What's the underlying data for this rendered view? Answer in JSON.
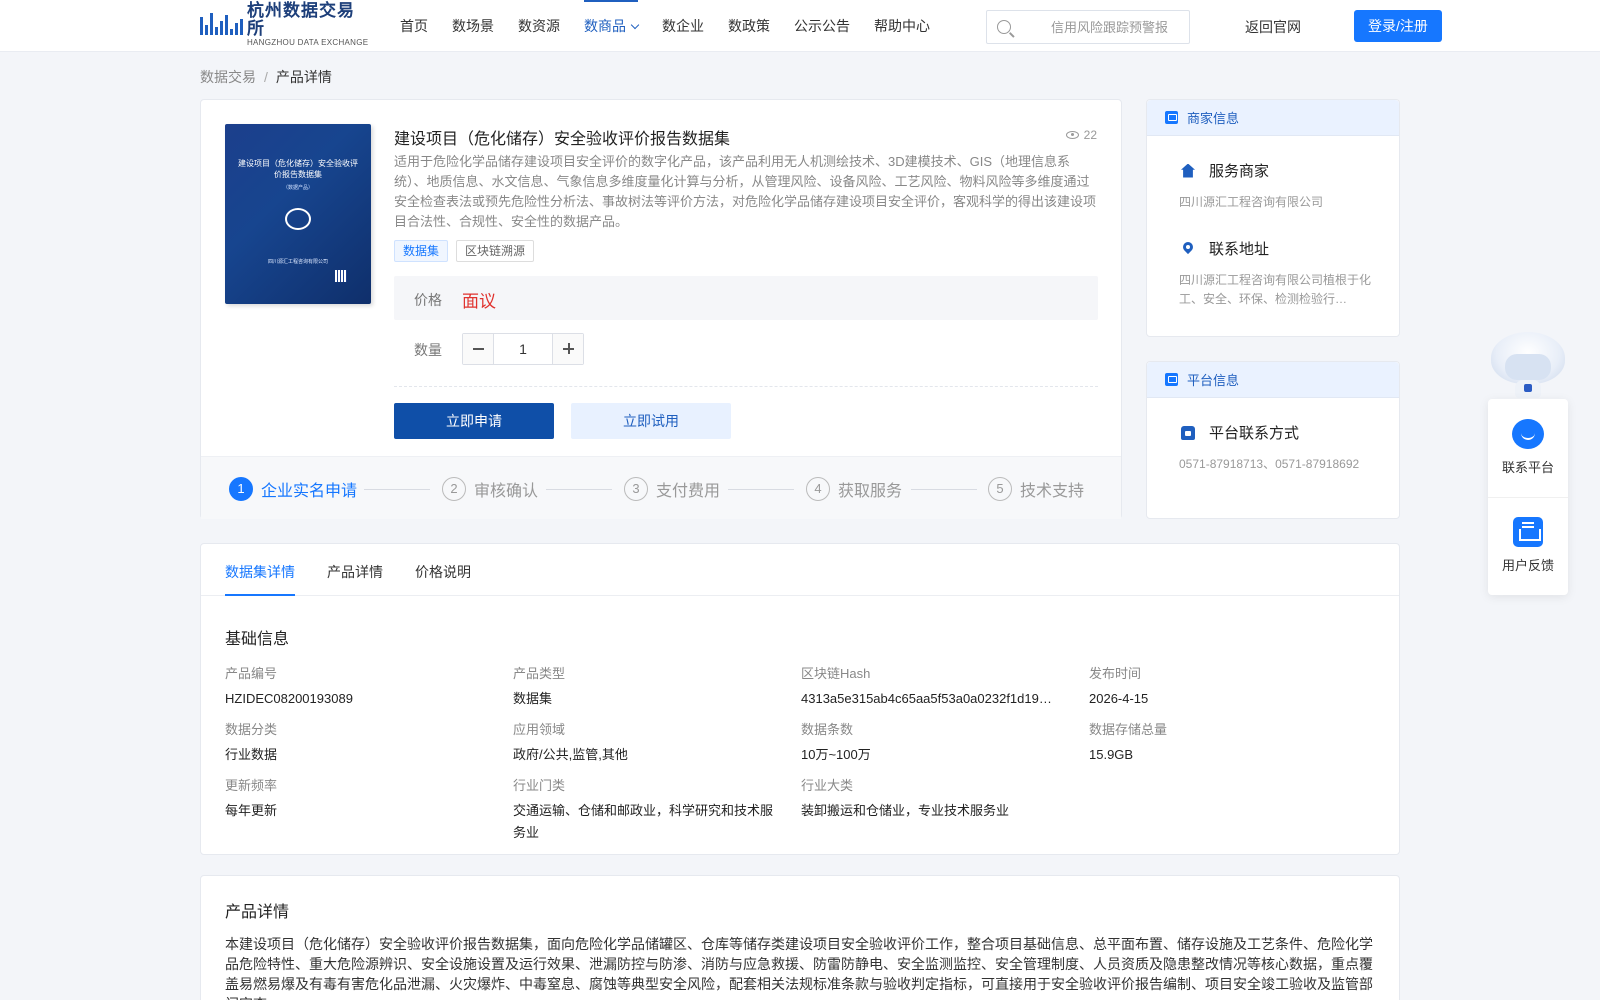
{
  "header": {
    "logo_cn": "杭州数据交易所",
    "logo_en": "HANGZHOU DATA EXCHANGE",
    "nav": [
      "首页",
      "数场景",
      "数资源",
      "数商品",
      "数企业",
      "数政策",
      "公示公告",
      "帮助中心"
    ],
    "active_nav": "数商品",
    "search_placeholder": "信用风险跟踪预警报",
    "back_link": "返回官网",
    "login": "登录/注册",
    "accent": "#1677ff"
  },
  "breadcrumb": {
    "root": "数据交易",
    "sep": "/",
    "current": "产品详情"
  },
  "product": {
    "cover_title": "建设项目（危化储存）安全验收评价报告数据集",
    "cover_sub": "（数据产品）",
    "cover_company": "四川源汇工程咨询有限公司",
    "title": "建设项目（危化储存）安全验收评价报告数据集",
    "views": "22",
    "description": "适用于危险化学品储存建设项目安全评价的数字化产品，该产品利用无人机测绘技术、3D建模技术、GIS（地理信息系统）、地质信息、水文信息、气象信息多维度量化计算与分析，从管理风险、设备风险、工艺风险、物料风险等多维度通过安全检查表法或预先危险性分析法、事故树法等评价方法，对危险化学品储存建设项目安全评价，客观科学的得出该建设项目合法性、合规性、安全性的数据产品。",
    "tags": [
      "数据集",
      "区块链溯源"
    ],
    "price_label": "价格",
    "price_value": "面议",
    "price_color": "#e0322e",
    "qty_label": "数量",
    "qty_value": "1",
    "apply_btn": "立即申请",
    "trial_btn": "立即试用",
    "steps": [
      {
        "num": "1",
        "label": "企业实名申请"
      },
      {
        "num": "2",
        "label": "审核确认"
      },
      {
        "num": "3",
        "label": "支付费用"
      },
      {
        "num": "4",
        "label": "获取服务"
      },
      {
        "num": "5",
        "label": "技术支持"
      }
    ]
  },
  "merchant": {
    "head": "商家信息",
    "service_label": "服务商家",
    "service_value": "四川源汇工程咨询有限公司",
    "address_label": "联系地址",
    "address_value": "四川源汇工程咨询有限公司植根于化工、安全、环保、检测检验行…"
  },
  "platform": {
    "head": "平台信息",
    "contact_label": "平台联系方式",
    "contact_value": "0571-87918713、0571-87918692"
  },
  "float": {
    "contact": "联系平台",
    "feedback": "用户反馈"
  },
  "detail": {
    "tabs": [
      "数据集详情",
      "产品详情",
      "价格说明"
    ],
    "basic_title": "基础信息",
    "fields": [
      {
        "k": "产品编号",
        "v": "HZIDEC08200193089"
      },
      {
        "k": "产品类型",
        "v": "数据集"
      },
      {
        "k": "区块链Hash",
        "v": "4313a5e315ab4c65aa5f53a0a0232f1d19…"
      },
      {
        "k": "发布时间",
        "v": "2026-4-15"
      },
      {
        "k": "数据分类",
        "v": "行业数据"
      },
      {
        "k": "应用领域",
        "v": "政府/公共,监管,其他"
      },
      {
        "k": "数据条数",
        "v": "10万~100万"
      },
      {
        "k": "数据存储总量",
        "v": "15.9GB"
      },
      {
        "k": "更新频率",
        "v": "每年更新"
      },
      {
        "k": "行业门类",
        "v": "交通运输、仓储和邮政业，科学研究和技术服务业"
      },
      {
        "k": "行业大类",
        "v": "装卸搬运和仓储业，专业技术服务业"
      }
    ]
  },
  "intro": {
    "title": "产品详情",
    "text": "本建设项目（危化储存）安全验收评价报告数据集，面向危险化学品储罐区、仓库等储存类建设项目安全验收评价工作，整合项目基础信息、总平面布置、储存设施及工艺条件、危险化学品危险特性、重大危险源辨识、安全设施设置及运行效果、泄漏防控与防渗、消防与应急救援、防雷防静电、安全监测监控、安全管理制度、人员资质及隐患整改情况等核心数据，重点覆盖易燃易爆及有毒有害危化品泄漏、火灾爆炸、中毒窒息、腐蚀等典型安全风险，配套相关法规标准条款与验收判定指标，可直接用于安全验收评价报告编制、项目安全竣工验收及监管部门审查。"
  }
}
